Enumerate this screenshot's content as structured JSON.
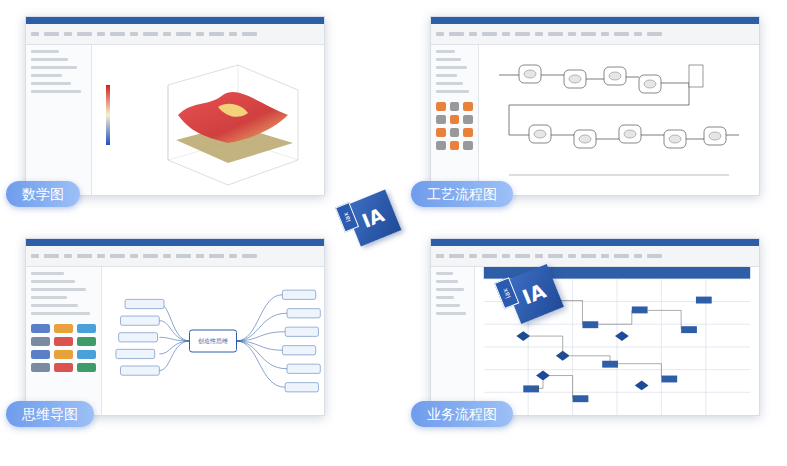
{
  "cards": [
    {
      "label": "数学图",
      "kind": "math"
    },
    {
      "label": "工艺流程图",
      "kind": "process"
    },
    {
      "label": "思维导图",
      "kind": "mindmap",
      "center": "创造性思维"
    },
    {
      "label": "业务流程图",
      "kind": "swimlane"
    }
  ],
  "logos": [
    {
      "big": "IA",
      "small": "iax"
    },
    {
      "big": "IA",
      "small": "iax"
    }
  ]
}
